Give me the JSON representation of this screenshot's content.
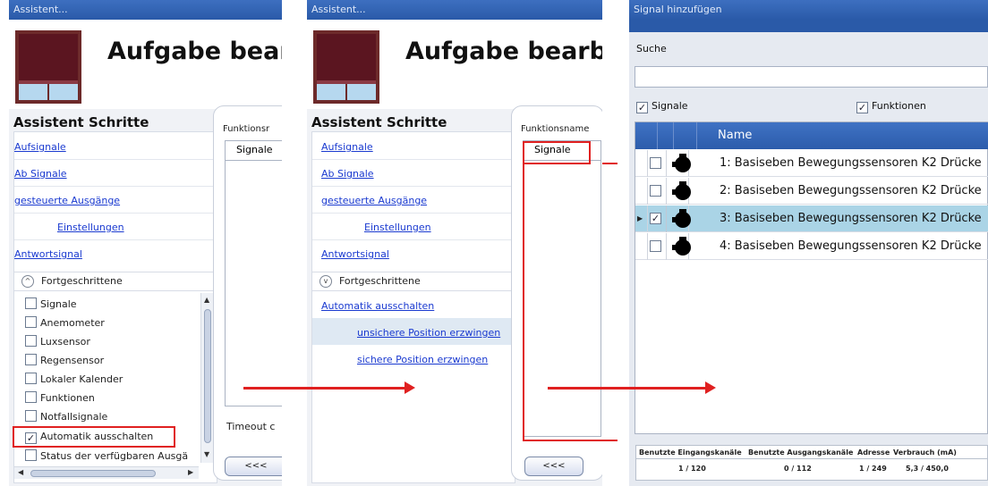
{
  "win1": {
    "title": "Assistent...",
    "header_title": "Aufgabe bearbe",
    "steps_heading": "Assistent Schritte",
    "steps": [
      "Aufsignale",
      "Ab Signale",
      "gesteuerte Ausgänge",
      "Einstellungen",
      "Antwortsignal"
    ],
    "advanced_label": "Fortgeschrittene",
    "checklist": [
      {
        "label": "Signale",
        "checked": false
      },
      {
        "label": "Anemometer",
        "checked": false
      },
      {
        "label": "Luxsensor",
        "checked": false
      },
      {
        "label": "Regensensor",
        "checked": false
      },
      {
        "label": "Lokaler Kalender",
        "checked": false
      },
      {
        "label": "Funktionen",
        "checked": false
      },
      {
        "label": "Notfallsignale",
        "checked": false
      },
      {
        "label": "Automatik ausschalten",
        "checked": true
      },
      {
        "label": "Status der verfügbaren Ausgä",
        "checked": false
      }
    ],
    "func_name_label": "Funktionsr",
    "tab_label": "Signale",
    "timeout_label": "Timeout c",
    "back_button": "<<<"
  },
  "win2": {
    "title": "Assistent...",
    "header_title": "Aufgabe bearbeit",
    "steps_heading": "Assistent Schritte",
    "steps": [
      "Aufsignale",
      "Ab Signale",
      "gesteuerte Ausgänge",
      "Einstellungen",
      "Antwortsignal"
    ],
    "advanced_label": "Fortgeschrittene",
    "adv_items": [
      "Automatik ausschalten",
      "unsichere Position erzwingen",
      "sichere Position erzwingen"
    ],
    "func_name_label": "Funktionsname",
    "tab_label": "Signale",
    "back_button": "<<<"
  },
  "win3": {
    "title": "Signal hinzufügen",
    "search_label": "Suche",
    "search_value": "",
    "filter_signals": {
      "label": "Signale",
      "checked": true
    },
    "filter_functions": {
      "label": "Funktionen",
      "checked": true
    },
    "column_name": "Name",
    "rows": [
      {
        "name": "1: Basiseben Bewegungssensoren K2 Drücke",
        "checked": false,
        "selected": false
      },
      {
        "name": "2: Basiseben Bewegungssensoren K2 Drücke",
        "checked": false,
        "selected": false
      },
      {
        "name": "3: Basiseben Bewegungssensoren K2 Drücke",
        "checked": true,
        "selected": true
      },
      {
        "name": "4: Basiseben Bewegungssensoren K2 Drücke",
        "checked": false,
        "selected": false
      }
    ],
    "status": {
      "h_in": "Benutzte Eingangskanäle",
      "h_out": "Benutzte Ausgangskanäle",
      "h_addr": "Adresse",
      "h_cons": "Verbrauch (mA)",
      "v_in": "1 / 120",
      "v_out": "0 / 112",
      "v_addr": "1 / 249",
      "v_cons": "5,3 / 450,0"
    }
  },
  "colors": {
    "accent_red": "#e02020",
    "link_blue": "#1a3ad0",
    "title_blue": "#2a5aa8",
    "selection": "#aad4e6"
  },
  "icons": [
    "window-blind-icon",
    "sensor-icon",
    "collapse-icon",
    "expand-icon",
    "arrow-right-icon"
  ]
}
